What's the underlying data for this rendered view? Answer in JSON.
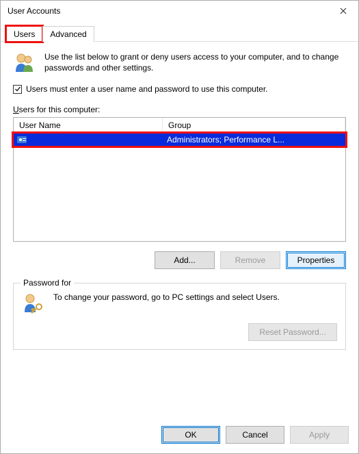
{
  "window": {
    "title": "User Accounts"
  },
  "tabs": {
    "users": "Users",
    "advanced": "Advanced"
  },
  "intro": "Use the list below to grant or deny users access to your computer, and to change passwords and other settings.",
  "checkbox": {
    "label": "Users must enter a user name and password to use this computer.",
    "checked": true
  },
  "list": {
    "label": "Users for this computer:",
    "columns": {
      "name": "User Name",
      "group": "Group"
    },
    "rows": [
      {
        "name": "",
        "group": "Administrators; Performance L..."
      }
    ]
  },
  "buttons": {
    "add": "Add...",
    "remove": "Remove",
    "properties": "Properties"
  },
  "password_section": {
    "legend": "Password for",
    "text": "To change your password, go to PC settings and select Users.",
    "reset": "Reset Password..."
  },
  "footer": {
    "ok": "OK",
    "cancel": "Cancel",
    "apply": "Apply"
  }
}
